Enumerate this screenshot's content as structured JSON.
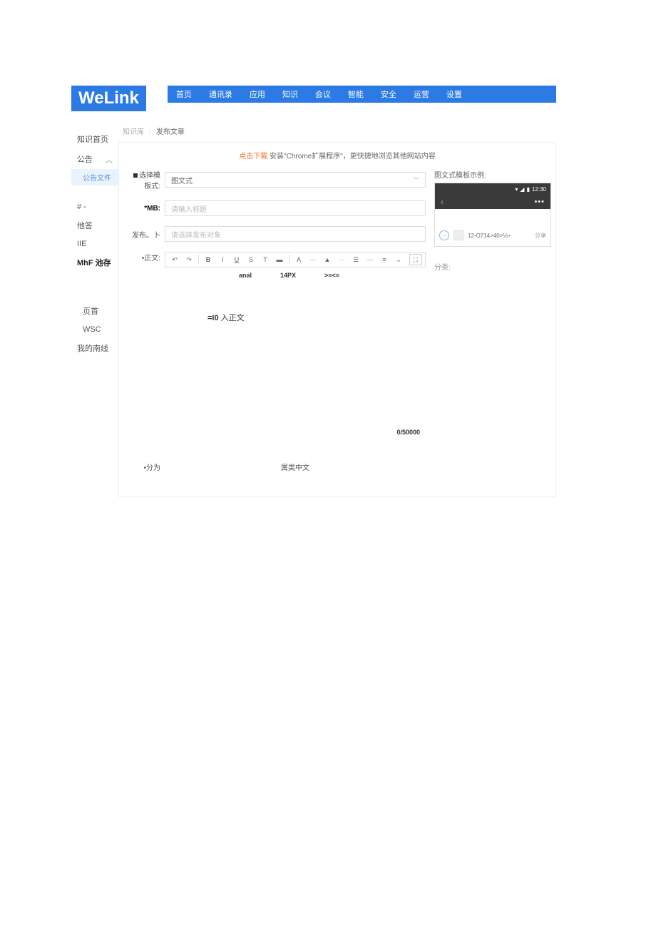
{
  "logo": "WeLink",
  "topnav": [
    "首页",
    "通讯录",
    "应用",
    "知识",
    "会议",
    "智能",
    "安全",
    "运营",
    "设置"
  ],
  "sidebar": {
    "knowledge_home": "知识首页",
    "bulletin": "公告",
    "bulletin_sub": "公告文件",
    "items": [
      "# -",
      "他答",
      "IIE"
    ],
    "mhf": "MhF 池存",
    "group2": [
      "页首",
      "WSC",
      "我的南线"
    ]
  },
  "breadcrumb": {
    "a": "知识库",
    "b": "发布文章"
  },
  "banner": {
    "link": "点击下载",
    "text": " 安装\"Chrome扩展程序\"，更快捷地浏览其他网站内容"
  },
  "fields": {
    "type_label": "选择模板式:",
    "type_value": "图文式",
    "title_label": "*MB:",
    "title_placeholder": "请输入标题",
    "publish_label": "发布。卜",
    "publish_placeholder": "请选择发布对象",
    "body_label": "•正文:",
    "category_label": "•分为",
    "category_center": "属类中文"
  },
  "toolbar2": {
    "anal": "anal",
    "px": "14PX",
    "align": ">≡<≡"
  },
  "editor": {
    "prefix": "=I0",
    "text": " 入正文"
  },
  "counter": "0/50000",
  "example": {
    "title": "图文式模板示例:",
    "status_time": "12:30",
    "item_text": "12-O714>40>⅓÷",
    "share": "分享",
    "cat": "分类:"
  }
}
